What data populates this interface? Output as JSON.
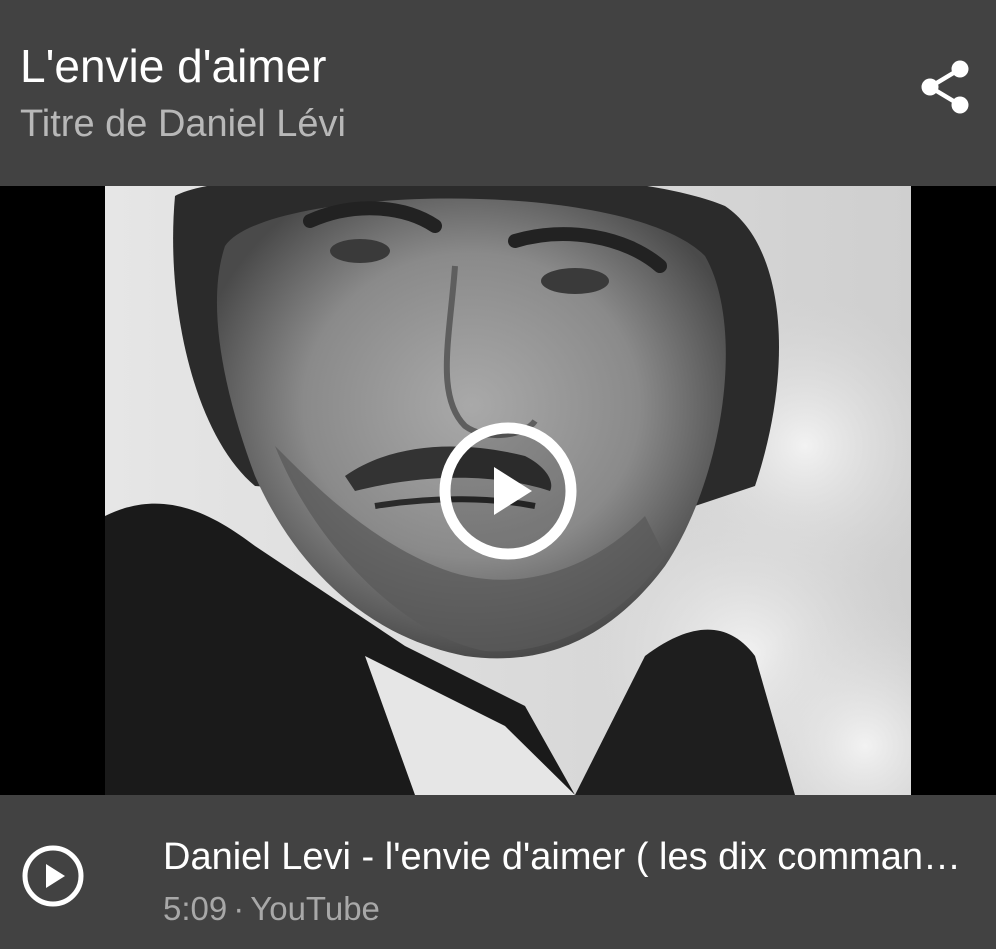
{
  "header": {
    "title": "L'envie d'aimer",
    "subtitle": "Titre de Daniel Lévi",
    "share_icon": "share-icon"
  },
  "video": {
    "thumbnail": "portrait-photo",
    "play_icon": "play-circle-icon"
  },
  "footer": {
    "play_icon": "play-circle-icon",
    "video_title": "Daniel Levi - l'envie d'aimer ( les dix commandements )",
    "duration": "5:09",
    "separator": "·",
    "source": "YouTube"
  },
  "colors": {
    "background": "#424242",
    "title": "#ffffff",
    "secondary_text": "#b8b8b8",
    "video_letterbox": "#000000"
  }
}
